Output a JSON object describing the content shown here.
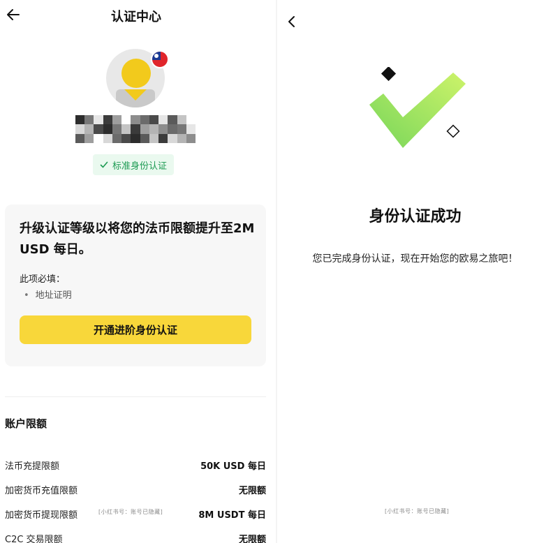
{
  "left": {
    "header": {
      "title": "认证中心"
    },
    "badge": {
      "label": "标准身份认证"
    },
    "upgrade": {
      "title": "升级认证等级以将您的法币限额提升至2M USD 每日。",
      "requirement_label": "此项必填：",
      "requirements": [
        "地址证明"
      ],
      "button_label": "开通进阶身份认证"
    },
    "limits": {
      "title": "账户限额",
      "rows": [
        {
          "label": "法币充提限额",
          "value": "50K USD 每日"
        },
        {
          "label": "加密货币充值限额",
          "value": "无限额"
        },
        {
          "label": "加密货币提现限额",
          "value": "8M USDT 每日"
        },
        {
          "label": "C2C 交易限额",
          "value": "无限额"
        }
      ]
    },
    "watermark": "[小红书号：账号已隐藏]"
  },
  "right": {
    "title": "身份认证成功",
    "description": "您已完成身份认证，现在开始您的欧易之旅吧！",
    "watermark": "[小红书号：账号已隐藏]"
  },
  "colors": {
    "accent_yellow": "#f8d73a",
    "verified_green": "#1c9a52",
    "check_green_light": "#cdf36a",
    "check_green_dark": "#78d65a"
  },
  "icons": [
    "back-arrow-icon",
    "checkmark-icon",
    "chevron-left-icon",
    "success-check-icon"
  ]
}
